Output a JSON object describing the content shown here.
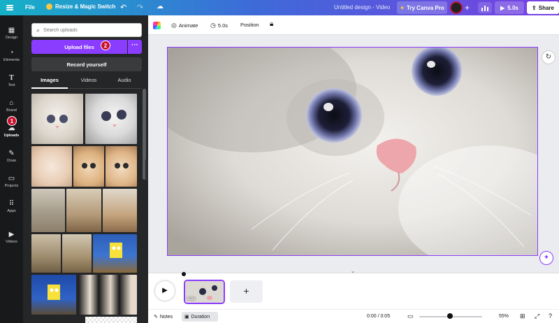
{
  "topbar": {
    "file": "File",
    "resize": "Resize & Magic Switch",
    "doc_title": "Untitled design - Video",
    "try_canva": "Try Canva Pro",
    "play_duration": "5.0s",
    "share": "Share"
  },
  "rail": {
    "items": [
      {
        "label": "Design",
        "icon": "design-icon"
      },
      {
        "label": "Elements",
        "icon": "elements-icon"
      },
      {
        "label": "Text",
        "icon": "text-icon"
      },
      {
        "label": "Brand",
        "icon": "brand-icon"
      },
      {
        "label": "Uploads",
        "icon": "uploads-icon"
      },
      {
        "label": "Draw",
        "icon": "draw-icon"
      },
      {
        "label": "Projects",
        "icon": "projects-icon"
      },
      {
        "label": "Apps",
        "icon": "apps-icon"
      },
      {
        "label": "Videos",
        "icon": "videos-icon"
      }
    ]
  },
  "panel": {
    "search_placeholder": "Search uploads",
    "upload_button": "Upload files",
    "more": "···",
    "record_button": "Record yourself",
    "tabs": [
      "Images",
      "Videos",
      "Audio"
    ]
  },
  "badges": {
    "one": "1",
    "two": "2"
  },
  "toolbar": {
    "animate": "Animate",
    "duration": "5.0s",
    "position": "Position"
  },
  "timeline": {
    "clip_duration": "5.0s",
    "add": "+"
  },
  "statusbar": {
    "notes": "Notes",
    "duration": "Duration",
    "time": "0:00 / 0:05",
    "zoom": "55%",
    "zoom_level": 0.55
  },
  "colors": {
    "accent": "#8b3dff",
    "badge": "#c8102e",
    "rail_bg": "#18191b",
    "panel_bg": "#252627"
  }
}
